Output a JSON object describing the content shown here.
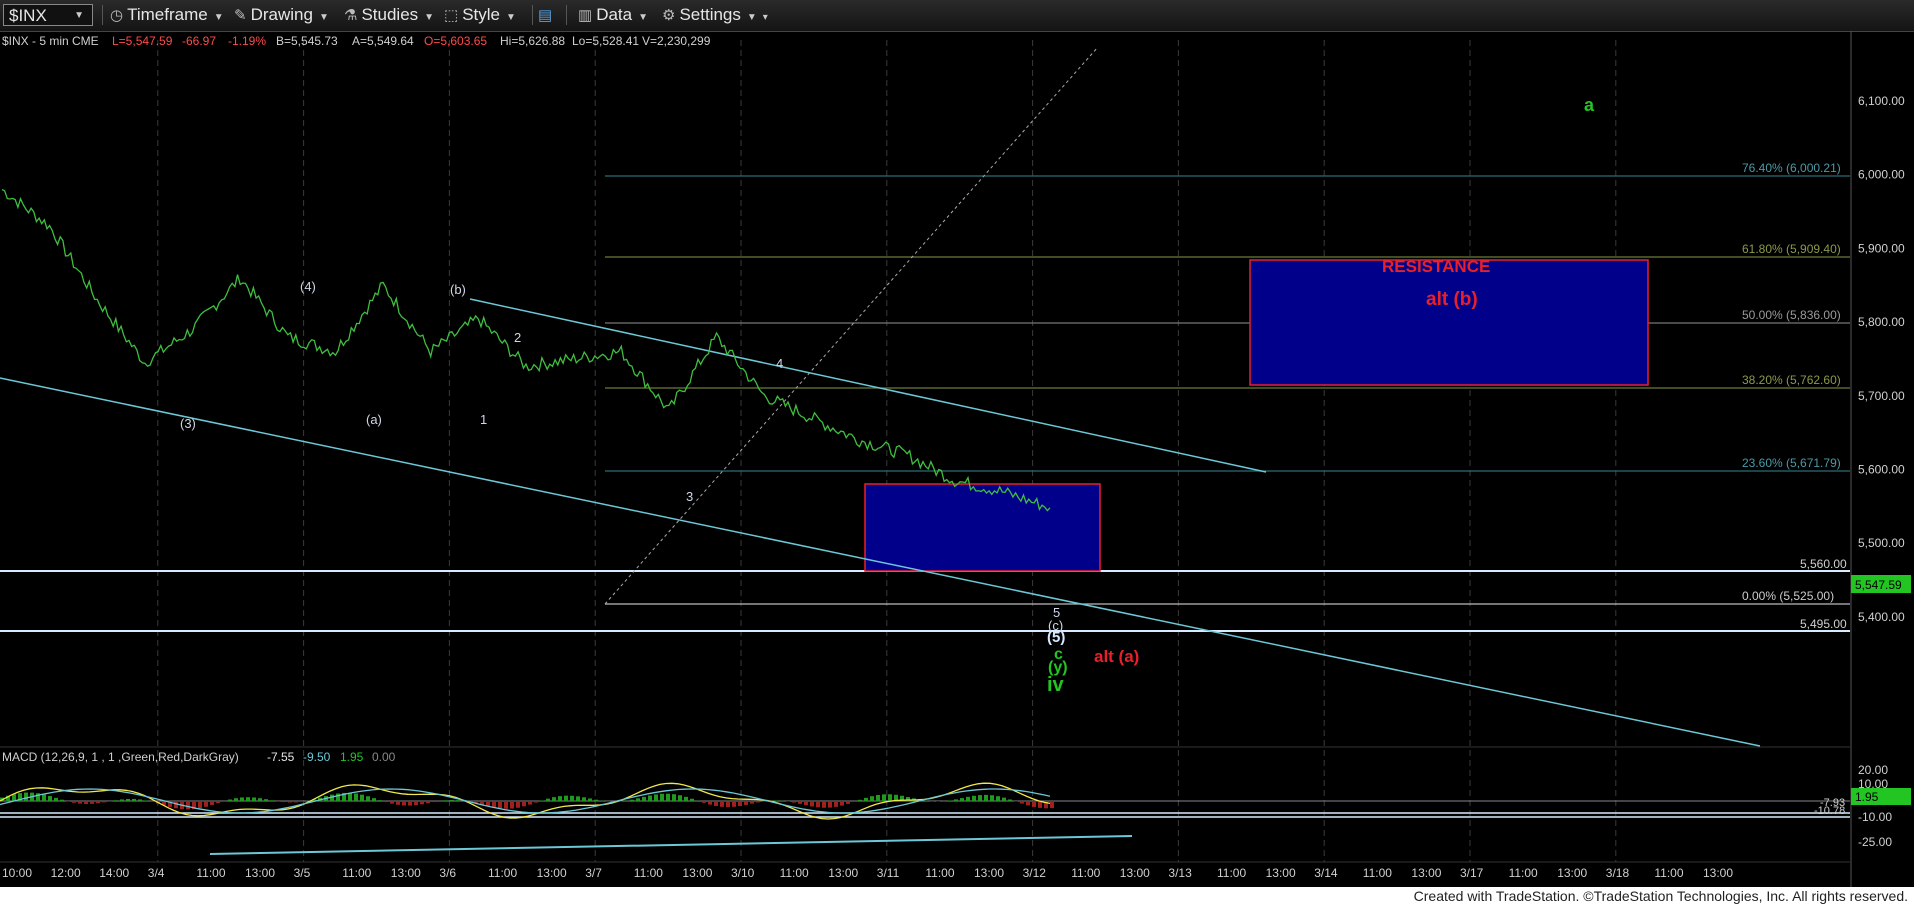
{
  "toolbar": {
    "symbol": "$INX",
    "timeframe": "Timeframe",
    "drawing": "Drawing",
    "studies": "Studies",
    "style": "Style",
    "data": "Data",
    "settings": "Settings"
  },
  "header": {
    "symbol_desc": "$INX - 5 min  CME",
    "last": "L=5,547.59",
    "change": "-66.97",
    "pct": "-1.19%",
    "bid": "B=5,545.73",
    "ask": "A=5,549.64",
    "open": "O=5,603.65",
    "hi": "Hi=5,626.88",
    "lo": "Lo=5,528.41",
    "vol": "V=2,230,299"
  },
  "macd_header": {
    "label": "MACD (12,26,9, 1 , 1 ,Green,Red,DarkGray)",
    "v1": "-7.55",
    "v2": "-9.50",
    "v3": "1.95",
    "v4": "0.00"
  },
  "price_axis": [
    "6,100.00",
    "6,000.00",
    "5,900.00",
    "5,800.00",
    "5,700.00",
    "5,600.00",
    "5,500.00",
    "5,400.00"
  ],
  "macd_axis": [
    "20.00",
    "10.00",
    "-10.00",
    "-25.00"
  ],
  "price_tags": {
    "last": "5,547.59",
    "level1": "5,560.00",
    "level2": "5,495.00"
  },
  "macd_tags": {
    "hist": "1.95",
    "a": "-7.93",
    "b": "-10.78"
  },
  "time_axis": [
    "10:00",
    "12:00",
    "14:00",
    "3/4",
    "11:00",
    "13:00",
    "3/5",
    "11:00",
    "13:00",
    "3/6",
    "11:00",
    "13:00",
    "3/7",
    "11:00",
    "13:00",
    "3/10",
    "11:00",
    "13:00",
    "3/11",
    "11:00",
    "13:00",
    "3/12",
    "11:00",
    "13:00",
    "3/13",
    "11:00",
    "13:00",
    "3/14",
    "11:00",
    "13:00",
    "3/17",
    "11:00",
    "13:00",
    "3/18",
    "11:00",
    "13:00"
  ],
  "fib_levels": [
    {
      "label": "76.40% (6,000.21)",
      "color": "#4a9aa6"
    },
    {
      "label": "61.80% (5,909.40)",
      "color": "#8a9a4a"
    },
    {
      "label": "50.00% (5,836.00)",
      "color": "#9a9a9a"
    },
    {
      "label": "38.20% (5,762.60)",
      "color": "#8a9a4a"
    },
    {
      "label": "23.60% (5,671.79)",
      "color": "#4a9aa6"
    },
    {
      "label": "0.00% (5,525.00)",
      "color": "#cccccc"
    }
  ],
  "annotations": {
    "w3": "(3)",
    "w4": "(4)",
    "wa": "(a)",
    "wb": "(b)",
    "n1": "1",
    "n2": "2",
    "n3": "3",
    "n4": "4",
    "n5": "5",
    "wc": "(c)",
    "w5": "(5)",
    "c": "c",
    "y": "(y)",
    "iv": "iv",
    "alt_a": "alt (a)",
    "alt_b": "alt (b)",
    "resistance": "RESISTANCE",
    "a": "a"
  },
  "colors": {
    "accent_red": "#e8202a",
    "green": "#22c522",
    "box_fill": "#000088",
    "channel": "#6cc8d6"
  },
  "footer": "Created with TradeStation. ©TradeStation Technologies, Inc. All rights reserved.",
  "chart_data": {
    "type": "line",
    "title": "$INX - 5 min",
    "ylim": [
      5340,
      6160
    ],
    "x": [
      "3/3 10:00",
      "3/3 13:00",
      "3/4 09:30",
      "3/4 11:00",
      "3/4 13:00",
      "3/5 09:30",
      "3/5 11:00",
      "3/5 13:00",
      "3/5 15:00",
      "3/6 09:30",
      "3/6 11:00",
      "3/6 13:00",
      "3/7 09:30",
      "3/7 11:00",
      "3/7 13:00",
      "3/7 15:00",
      "3/10 09:30",
      "3/10 11:00",
      "3/10 13:00",
      "3/11 09:30",
      "3/11 11:00",
      "3/11 13:00",
      "3/11 14:00"
    ],
    "series": [
      {
        "values": [
          5980,
          5930,
          5830,
          5745,
          5790,
          5860,
          5780,
          5760,
          5850,
          5760,
          5805,
          5740,
          5750,
          5760,
          5680,
          5780,
          5700,
          5670,
          5640,
          5620,
          5585,
          5570,
          5548
        ]
      }
    ],
    "macd": {
      "line": [
        -7.55
      ],
      "signal": [
        -9.5
      ],
      "histogram": [
        1.95
      ]
    }
  }
}
